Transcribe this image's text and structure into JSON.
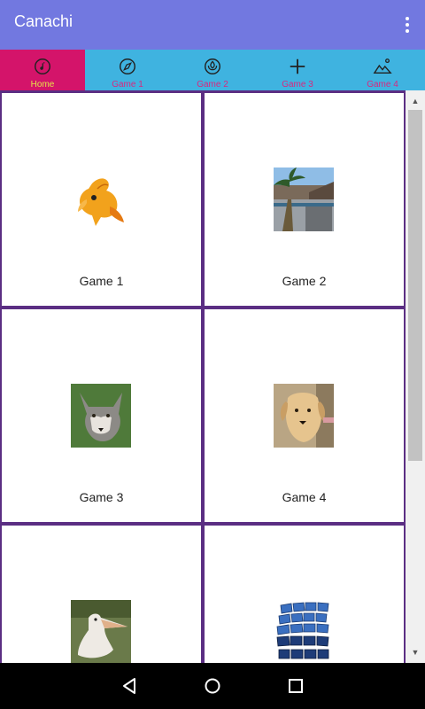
{
  "app": {
    "title": "Canachi"
  },
  "tabs": [
    {
      "label": "Home",
      "icon": "music-note-circle-icon",
      "active": true
    },
    {
      "label": "Game 1",
      "icon": "compass-icon",
      "active": false
    },
    {
      "label": "Game 2",
      "icon": "nature-circle-icon",
      "active": false
    },
    {
      "label": "Game 3",
      "icon": "plus-icon",
      "active": false
    },
    {
      "label": "Game 4",
      "icon": "mountains-icon",
      "active": false
    }
  ],
  "grid": {
    "items": [
      {
        "label": "Game 1",
        "image": "goldfish"
      },
      {
        "label": "Game 2",
        "image": "seaside-palm"
      },
      {
        "label": "Game 3",
        "image": "wolf"
      },
      {
        "label": "Game 4",
        "image": "dog"
      },
      {
        "label": "",
        "image": "pelican"
      },
      {
        "label": "",
        "image": "blue-tiles"
      }
    ]
  },
  "colors": {
    "appbar": "#7278e0",
    "tabbar": "#3fb3e0",
    "tab_active_bg": "#d4146a",
    "tab_active_text": "#e6e24a",
    "tab_text": "#d8287f",
    "grid_border": "#5b2e83"
  },
  "navbar": {
    "icons": [
      "back-icon",
      "home-icon",
      "recents-icon"
    ]
  }
}
